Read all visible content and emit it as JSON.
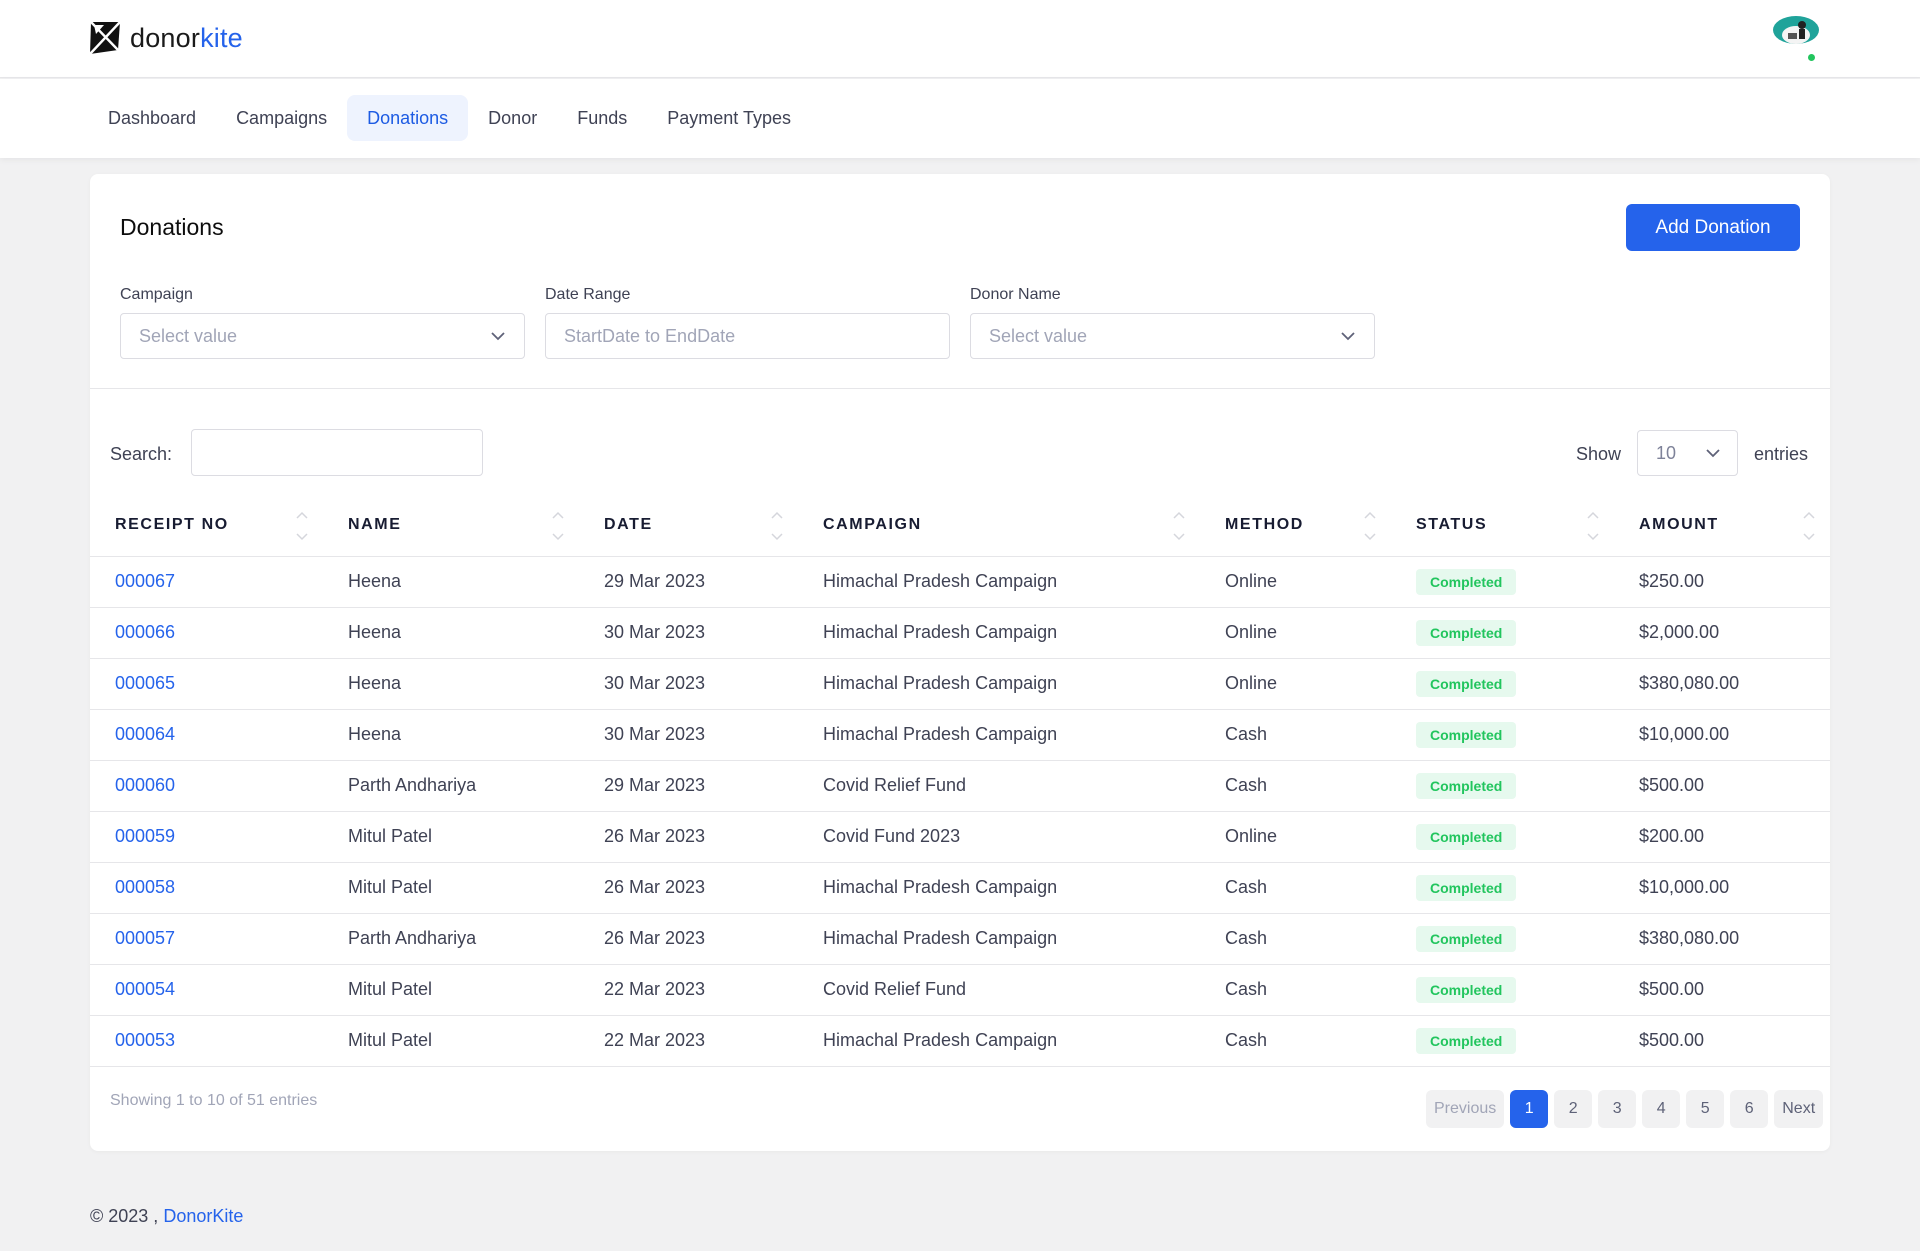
{
  "header": {
    "logo": {
      "part1": "donor",
      "part2": "kite"
    }
  },
  "nav": {
    "items": [
      {
        "label": "Dashboard",
        "active": false
      },
      {
        "label": "Campaigns",
        "active": false
      },
      {
        "label": "Donations",
        "active": true
      },
      {
        "label": "Donor",
        "active": false
      },
      {
        "label": "Funds",
        "active": false
      },
      {
        "label": "Payment Types",
        "active": false
      }
    ]
  },
  "page": {
    "title": "Donations",
    "add_button": "Add Donation",
    "filters": {
      "campaign": {
        "label": "Campaign",
        "placeholder": "Select value"
      },
      "date_range": {
        "label": "Date Range",
        "placeholder": "StartDate to EndDate"
      },
      "donor_name": {
        "label": "Donor Name",
        "placeholder": "Select value"
      }
    },
    "search": {
      "label": "Search:",
      "value": ""
    },
    "show": {
      "label": "Show",
      "value": "10",
      "suffix": "entries"
    }
  },
  "table": {
    "columns": [
      "RECEIPT NO",
      "NAME",
      "DATE",
      "CAMPAIGN",
      "METHOD",
      "STATUS",
      "AMOUNT"
    ],
    "rows": [
      {
        "receipt": "000067",
        "name": "Heena",
        "date": "29 Mar 2023",
        "campaign": "Himachal Pradesh Campaign",
        "method": "Online",
        "status": "Completed",
        "amount": "$250.00"
      },
      {
        "receipt": "000066",
        "name": "Heena",
        "date": "30 Mar 2023",
        "campaign": "Himachal Pradesh Campaign",
        "method": "Online",
        "status": "Completed",
        "amount": "$2,000.00"
      },
      {
        "receipt": "000065",
        "name": "Heena",
        "date": "30 Mar 2023",
        "campaign": "Himachal Pradesh Campaign",
        "method": "Online",
        "status": "Completed",
        "amount": "$380,080.00"
      },
      {
        "receipt": "000064",
        "name": "Heena",
        "date": "30 Mar 2023",
        "campaign": "Himachal Pradesh Campaign",
        "method": "Cash",
        "status": "Completed",
        "amount": "$10,000.00"
      },
      {
        "receipt": "000060",
        "name": "Parth Andhariya",
        "date": "29 Mar 2023",
        "campaign": "Covid Relief Fund",
        "method": "Cash",
        "status": "Completed",
        "amount": "$500.00"
      },
      {
        "receipt": "000059",
        "name": "Mitul Patel",
        "date": "26 Mar 2023",
        "campaign": "Covid Fund 2023",
        "method": "Online",
        "status": "Completed",
        "amount": "$200.00"
      },
      {
        "receipt": "000058",
        "name": "Mitul Patel",
        "date": "26 Mar 2023",
        "campaign": "Himachal Pradesh Campaign",
        "method": "Cash",
        "status": "Completed",
        "amount": "$10,000.00"
      },
      {
        "receipt": "000057",
        "name": "Parth Andhariya",
        "date": "26 Mar 2023",
        "campaign": "Himachal Pradesh Campaign",
        "method": "Cash",
        "status": "Completed",
        "amount": "$380,080.00"
      },
      {
        "receipt": "000054",
        "name": "Mitul Patel",
        "date": "22 Mar 2023",
        "campaign": "Covid Relief Fund",
        "method": "Cash",
        "status": "Completed",
        "amount": "$500.00"
      },
      {
        "receipt": "000053",
        "name": "Mitul Patel",
        "date": "22 Mar 2023",
        "campaign": "Himachal Pradesh Campaign",
        "method": "Cash",
        "status": "Completed",
        "amount": "$500.00"
      }
    ]
  },
  "pagination": {
    "info": "Showing 1 to 10 of 51 entries",
    "previous": "Previous",
    "next": "Next",
    "pages": [
      "1",
      "2",
      "3",
      "4",
      "5",
      "6"
    ],
    "current": "1"
  },
  "footer": {
    "copyright": "© 2023 ,",
    "brand": "DonorKite"
  },
  "colors": {
    "primary": "#2563eb",
    "success": "#22c55e",
    "success_bg": "#e6f9ee"
  }
}
